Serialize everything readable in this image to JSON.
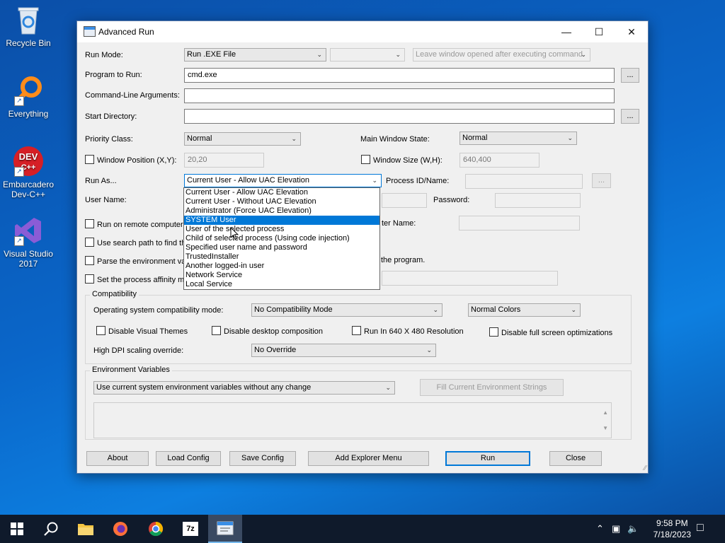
{
  "desktop": {
    "icons": [
      {
        "label": "Recycle Bin"
      },
      {
        "label": "Everything"
      },
      {
        "label": "Embarcadero Dev-C++"
      },
      {
        "label": "Visual Studio 2017"
      }
    ]
  },
  "window": {
    "title": "Advanced Run",
    "run_mode": {
      "label": "Run Mode:",
      "value": "Run .EXE File",
      "secondary_value": "",
      "after_exec": "Leave window opened after executing command"
    },
    "program": {
      "label": "Program to Run:",
      "value": "cmd.exe",
      "browse": "..."
    },
    "cmd_args": {
      "label": "Command-Line Arguments:",
      "value": ""
    },
    "start_dir": {
      "label": "Start Directory:",
      "value": "",
      "browse": "..."
    },
    "priority": {
      "label": "Priority Class:",
      "value": "Normal"
    },
    "main_window_state": {
      "label": "Main Window State:",
      "value": "Normal"
    },
    "window_position": {
      "label": "Window Position (X,Y):",
      "value": "20,20"
    },
    "window_size": {
      "label": "Window Size (W,H):",
      "value": "640,400"
    },
    "run_as": {
      "label": "Run As...",
      "value": "Current User - Allow UAC Elevation"
    },
    "process_id": {
      "label": "Process ID/Name:",
      "value": "",
      "browse": "..."
    },
    "user_name": {
      "label": "User Name:"
    },
    "password": {
      "label": "Password:"
    },
    "remote": {
      "label": "Run on remote computer",
      "computer_name_label": "ter Name:"
    },
    "search_path": {
      "label": "Use search path to find th"
    },
    "parse_env": {
      "label": "Parse the environment va",
      "suffix": "the program."
    },
    "affinity": {
      "label": "Set the process affinity m"
    },
    "dropdown_options": [
      "Current User - Allow UAC Elevation",
      "Current User - Without UAC Elevation",
      "Administrator (Force UAC Elevation)",
      "SYSTEM User",
      "User of the selected process",
      "Child of selected process (Using code injection)",
      "Specified user name and password",
      "TrustedInstaller",
      "Another logged-in user",
      "Network Service",
      "Local Service"
    ],
    "dropdown_selected_index": 3,
    "compat": {
      "title": "Compatibility",
      "os_label": "Operating system compatibility mode:",
      "os_value": "No Compatibility Mode",
      "colors_value": "Normal Colors",
      "disable_themes": "Disable Visual Themes",
      "disable_composition": "Disable desktop composition",
      "run_640": "Run In 640 X 480 Resolution",
      "disable_fullscreen": "Disable full screen optimizations",
      "dpi_label": "High DPI scaling override:",
      "dpi_value": "No Override"
    },
    "env": {
      "title": "Environment Variables",
      "mode_value": "Use current system environment variables without any change",
      "fill_button": "Fill Current Environment Strings"
    },
    "buttons": {
      "about": "About",
      "load_config": "Load Config",
      "save_config": "Save Config",
      "add_explorer_menu": "Add Explorer Menu",
      "run": "Run",
      "close": "Close"
    }
  },
  "taskbar": {
    "time": "9:58 PM",
    "date": "7/18/2023",
    "sevenzip_label": "7z"
  }
}
